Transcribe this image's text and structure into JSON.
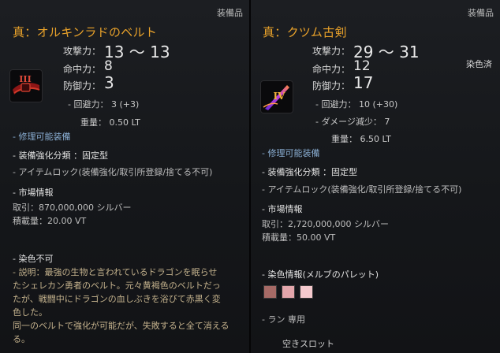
{
  "left": {
    "category": "装備品",
    "title": "真：オルキンラドのベルト",
    "icon": "belt-icon",
    "enhance_badge": "III",
    "stats": {
      "attack_label": "攻撃力：",
      "attack_value": "13 ～ 13",
      "accuracy_label": "命中力：",
      "accuracy_value": "8",
      "defense_label": "防御力：",
      "defense_value": "3",
      "evasion": "- 回避力：  3 (+3)",
      "weight": "重量：  0.50 LT"
    },
    "repairable": "- 修理可能装備",
    "enhance_type": "- 装備強化分類 ：固定型",
    "item_lock": "- アイテムロック(装備強化/取引所登録/捨てる不可)",
    "market_title": "- 市場情報",
    "trade": "取引：870,000,000 シルバー",
    "capacity": "積載量：20.00 VT",
    "dye": "- 染色不可",
    "description": [
      "- 説明：最強の生物と言われているドラゴンを眠らせ",
      "たシェレカン勇者のベルト。元々黄褐色のベルトだっ",
      "たが、戦闘中にドラゴンの血しぶきを浴びて赤黒く変",
      "色した。",
      "同一のベルトで強化が可能だが、失敗すると全て消える",
      "る。"
    ]
  },
  "right": {
    "category": "装備品",
    "title": "真：クツム古剣",
    "icon": "sword-icon",
    "enhance_badge": "IV",
    "dyed": "染色済",
    "stats": {
      "attack_label": "攻撃力：",
      "attack_value": "29 ～ 31",
      "accuracy_label": "命中力：",
      "accuracy_value": "12",
      "defense_label": "防御力：",
      "defense_value": "17",
      "evasion": "- 回避力：  10 (+30)",
      "damage_reduction": "- ダメージ減少：  7",
      "weight": "重量：  6.50 LT"
    },
    "repairable": "- 修理可能装備",
    "enhance_type": "- 装備強化分類 ：固定型",
    "item_lock": "- アイテムロック(装備強化/取引所登録/捨てる不可)",
    "market_title": "- 市場情報",
    "trade": "取引：2,720,000,000 シルバー",
    "capacity": "積載量：50.00 VT",
    "dye_info": "- 染色情報(メルブのパレット)",
    "dye_colors": [
      "#a66a66",
      "#e3a6ab",
      "#f4c9cd"
    ],
    "class": "- ラン 専用",
    "slot": "空きスロット"
  }
}
